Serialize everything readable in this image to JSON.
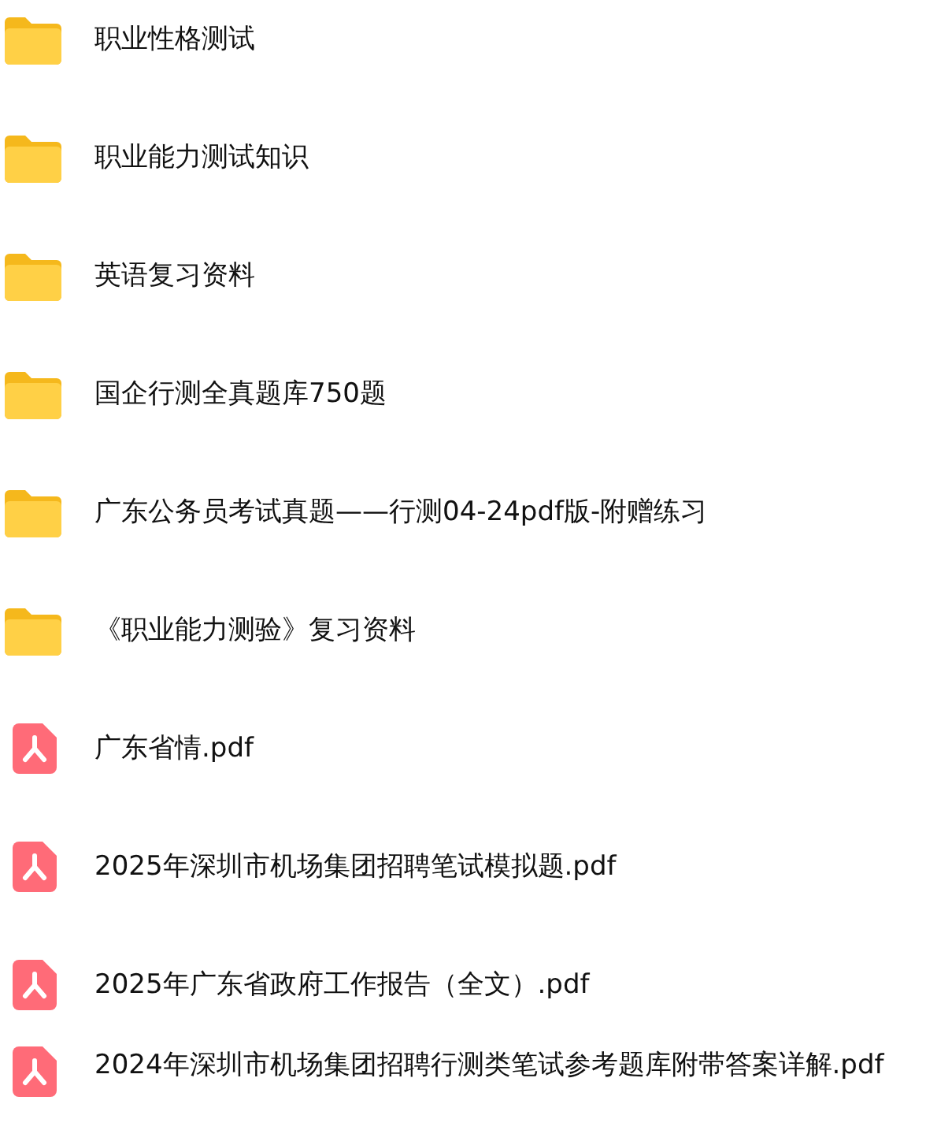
{
  "files": [
    {
      "kind": "folder",
      "name": "职业性格测试"
    },
    {
      "kind": "folder",
      "name": "职业能力测试知识"
    },
    {
      "kind": "folder",
      "name": "英语复习资料"
    },
    {
      "kind": "folder",
      "name": "国企行测全真题库750题"
    },
    {
      "kind": "folder",
      "name": "广东公务员考试真题——行测04-24pdf版-附赠练习"
    },
    {
      "kind": "folder",
      "name": "《职业能力测验》复习资料"
    },
    {
      "kind": "pdf",
      "name": "广东省情.pdf"
    },
    {
      "kind": "pdf",
      "name": "2025年深圳市机场集团招聘笔试模拟题.pdf"
    },
    {
      "kind": "pdf",
      "name": "2025年广东省政府工作报告（全文）.pdf"
    },
    {
      "kind": "pdf",
      "name": "2024年深圳市机场集团招聘行测类笔试参考题库附带答案详解.pdf"
    }
  ]
}
